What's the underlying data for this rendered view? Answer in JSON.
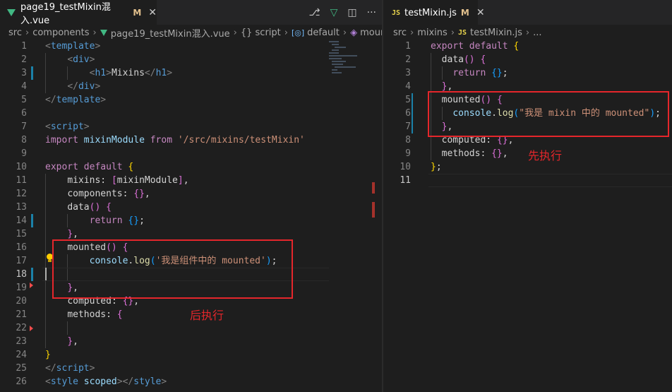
{
  "left_editor": {
    "tab": {
      "filename": "page19_testMixin混入.vue",
      "modified_flag": "M",
      "close": "✕"
    },
    "actions": [
      "⎇",
      "▽",
      "◫",
      "···"
    ],
    "breadcrumb": [
      "src",
      "components",
      "page19_testMixin混入.vue",
      "{} script",
      "default",
      "mounted"
    ],
    "breadcrumb_icons": {
      "file": "vue-icon",
      "default": "object-icon",
      "mounted": "method-cube-icon"
    },
    "line_numbers": [
      "1",
      "2",
      "3",
      "4",
      "5",
      "6",
      "7",
      "8",
      "9",
      "10",
      "11",
      "12",
      "13",
      "14",
      "15",
      "16",
      "17",
      "18",
      "19",
      "20",
      "21",
      "22",
      "23",
      "24",
      "25",
      "26"
    ],
    "code": {
      "l1_open": "<",
      "l1_tag": "template",
      "l1_close": ">",
      "l2_open": "<",
      "l2_tag": "div",
      "l2_close": ">",
      "l3_open": "<",
      "l3_tag": "h1",
      "l3_mid": ">",
      "l3_text": "Mixins",
      "l3_open2": "</",
      "l3_tag2": "h1",
      "l3_close": ">",
      "l4_open": "</",
      "l4_tag": "div",
      "l4_close": ">",
      "l5_open": "</",
      "l5_tag": "template",
      "l5_close": ">",
      "l7_open": "<",
      "l7_tag": "script",
      "l7_close": ">",
      "l8_import": "import",
      "l8_name": "mixinModule",
      "l8_from": "from",
      "l8_path": "'/src/mixins/testMixin'",
      "l10_export": "export",
      "l10_default": "default",
      "l10_brace": "{",
      "l11_key": "mixins",
      "l11_colon": ": ",
      "l11_open": "[",
      "l11_val": "mixinModule",
      "l11_close": "]",
      "l11_comma": ",",
      "l12_key": "components",
      "l12_colon": ": ",
      "l12_val": "{}",
      "l12_comma": ",",
      "l13_key": "data",
      "l13_paren": "()",
      "l13_brace": "{",
      "l14_return": "return",
      "l14_val": "{}",
      "l14_semi": ";",
      "l15_brace": "}",
      "l15_comma": ",",
      "l16_key": "mounted",
      "l16_paren": "()",
      "l16_brace": "{",
      "l17_obj": "console",
      "l17_dot": ".",
      "l17_fn": "log",
      "l17_open": "(",
      "l17_str": "'我是组件中的 mounted'",
      "l17_close": ")",
      "l17_semi": ";",
      "l19_brace": "}",
      "l19_comma": ",",
      "l20_key": "computed",
      "l20_colon": ": ",
      "l20_val": "{}",
      "l20_comma": ",",
      "l21_key": "methods",
      "l21_colon": ": ",
      "l21_brace": "{",
      "l23_brace": "}",
      "l23_comma": ",",
      "l24_brace": "}",
      "l25_open": "</",
      "l25_tag": "script",
      "l25_close": ">",
      "l26_open": "<",
      "l26_tag": "style",
      "l26_attr": "scoped",
      "l26_mid": "></",
      "l26_tag2": "style",
      "l26_close": ">"
    },
    "annotation": "后执行"
  },
  "right_editor": {
    "tab": {
      "icon_text": "JS",
      "filename": "testMixin.js",
      "modified_flag": "M",
      "close": "✕"
    },
    "breadcrumb": [
      "src",
      "mixins",
      "testMixin.js",
      "..."
    ],
    "line_numbers": [
      "1",
      "2",
      "3",
      "4",
      "5",
      "6",
      "7",
      "8",
      "9",
      "10",
      "11"
    ],
    "code": {
      "r1_export": "export",
      "r1_default": "default",
      "r1_brace": "{",
      "r2_key": "data",
      "r2_paren": "()",
      "r2_brace": "{",
      "r3_return": "return",
      "r3_val": "{}",
      "r3_semi": ";",
      "r4_brace": "}",
      "r4_comma": ",",
      "r5_key": "mounted",
      "r5_paren": "()",
      "r5_brace": "{",
      "r6_obj": "console",
      "r6_dot": ".",
      "r6_fn": "log",
      "r6_open": "(",
      "r6_str": "\"我是 mixin 中的 mounted\"",
      "r6_close": ")",
      "r6_semi": ";",
      "r7_brace": "}",
      "r7_comma": ",",
      "r8_key": "computed",
      "r8_colon": ": ",
      "r8_val": "{}",
      "r8_comma": ",",
      "r9_key": "methods",
      "r9_colon": ": ",
      "r9_val": "{}",
      "r9_comma": ",",
      "r10_brace": "}",
      "r10_semi": ";"
    },
    "annotation": "先执行"
  },
  "colors": {
    "annotation_red": "#e5262b",
    "background": "#1e1e1e",
    "modified": "#e2c08d"
  }
}
